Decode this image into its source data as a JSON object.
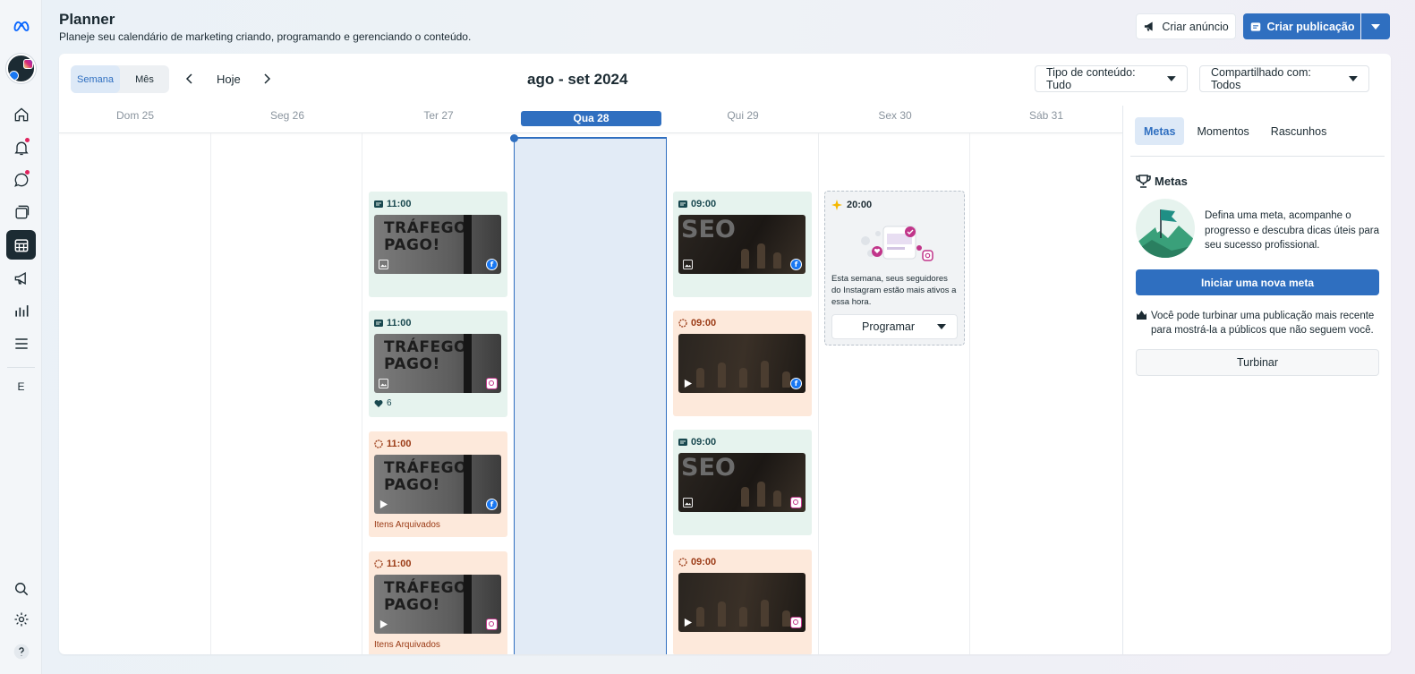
{
  "header": {
    "title": "Planner",
    "subtitle": "Planeje seu calendário de marketing criando, programando e gerenciando o conteúdo.",
    "create_ad": "Criar anúncio",
    "create_post": "Criar publicação"
  },
  "rail": {
    "icons": [
      "meta-logo-icon",
      "home-icon",
      "notifications-icon",
      "inbox-icon",
      "content-icon",
      "planner-icon",
      "ads-icon",
      "insights-icon",
      "menu-icon",
      "search-icon",
      "settings-icon",
      "help-icon"
    ],
    "letter": "E"
  },
  "toolbar": {
    "view_week": "Semana",
    "view_month": "Mês",
    "today": "Hoje",
    "range": "ago - set 2024",
    "filter_type": "Tipo de conteúdo: Tudo",
    "filter_shared": "Compartilhado com: Todos"
  },
  "calendar": {
    "days": [
      "Dom 25",
      "Seg 26",
      "Ter 27",
      "Qua 28",
      "Qui 29",
      "Sex 30",
      "Sáb 31"
    ],
    "today_index": 3,
    "posts": [
      {
        "time": "11:00",
        "status": "published",
        "thumb_text": "TRÁFEGO PAGO!",
        "network": "facebook"
      },
      {
        "time": "11:00",
        "status": "published",
        "thumb_text": "TRÁFEGO PAGO!",
        "network": "instagram",
        "likes": "6"
      },
      {
        "time": "11:00",
        "status": "archived",
        "thumb_text": "TRÁFEGO PAGO!",
        "network": "facebook",
        "note": "Itens Arquivados"
      },
      {
        "time": "11:00",
        "status": "archived",
        "thumb_text": "TRÁFEGO PAGO!",
        "network": "instagram",
        "note": "Itens Arquivados"
      },
      {
        "time": "09:00",
        "status": "published",
        "thumb_text": "SEO",
        "network": "facebook"
      },
      {
        "time": "09:00",
        "status": "scheduled",
        "network": "facebook"
      },
      {
        "time": "09:00",
        "status": "published",
        "thumb_text": "SEO",
        "network": "instagram"
      },
      {
        "time": "09:00",
        "status": "scheduled",
        "network": "instagram"
      }
    ],
    "suggestion": {
      "time": "20:00",
      "text": "Esta semana, seus seguidores do Instagram estão mais ativos a essa hora.",
      "button": "Programar"
    }
  },
  "side": {
    "tabs": [
      "Metas",
      "Momentos",
      "Rascunhos"
    ],
    "goal_title": "Metas",
    "goal_desc": "Defina uma meta, acompanhe o progresso e descubra dicas úteis para seu sucesso profissional.",
    "goal_button": "Iniciar uma nova meta",
    "boost_note": "Você pode turbinar uma publicação mais recente para mostrá-la a públicos que não seguem você.",
    "boost_button": "Turbinar"
  },
  "colors": {
    "accent": "#2f6fc0",
    "published_bg": "#e6f3ee",
    "scheduled_bg": "#fde9db",
    "facebook": "#1877f2",
    "instagram": "#c1358a"
  }
}
